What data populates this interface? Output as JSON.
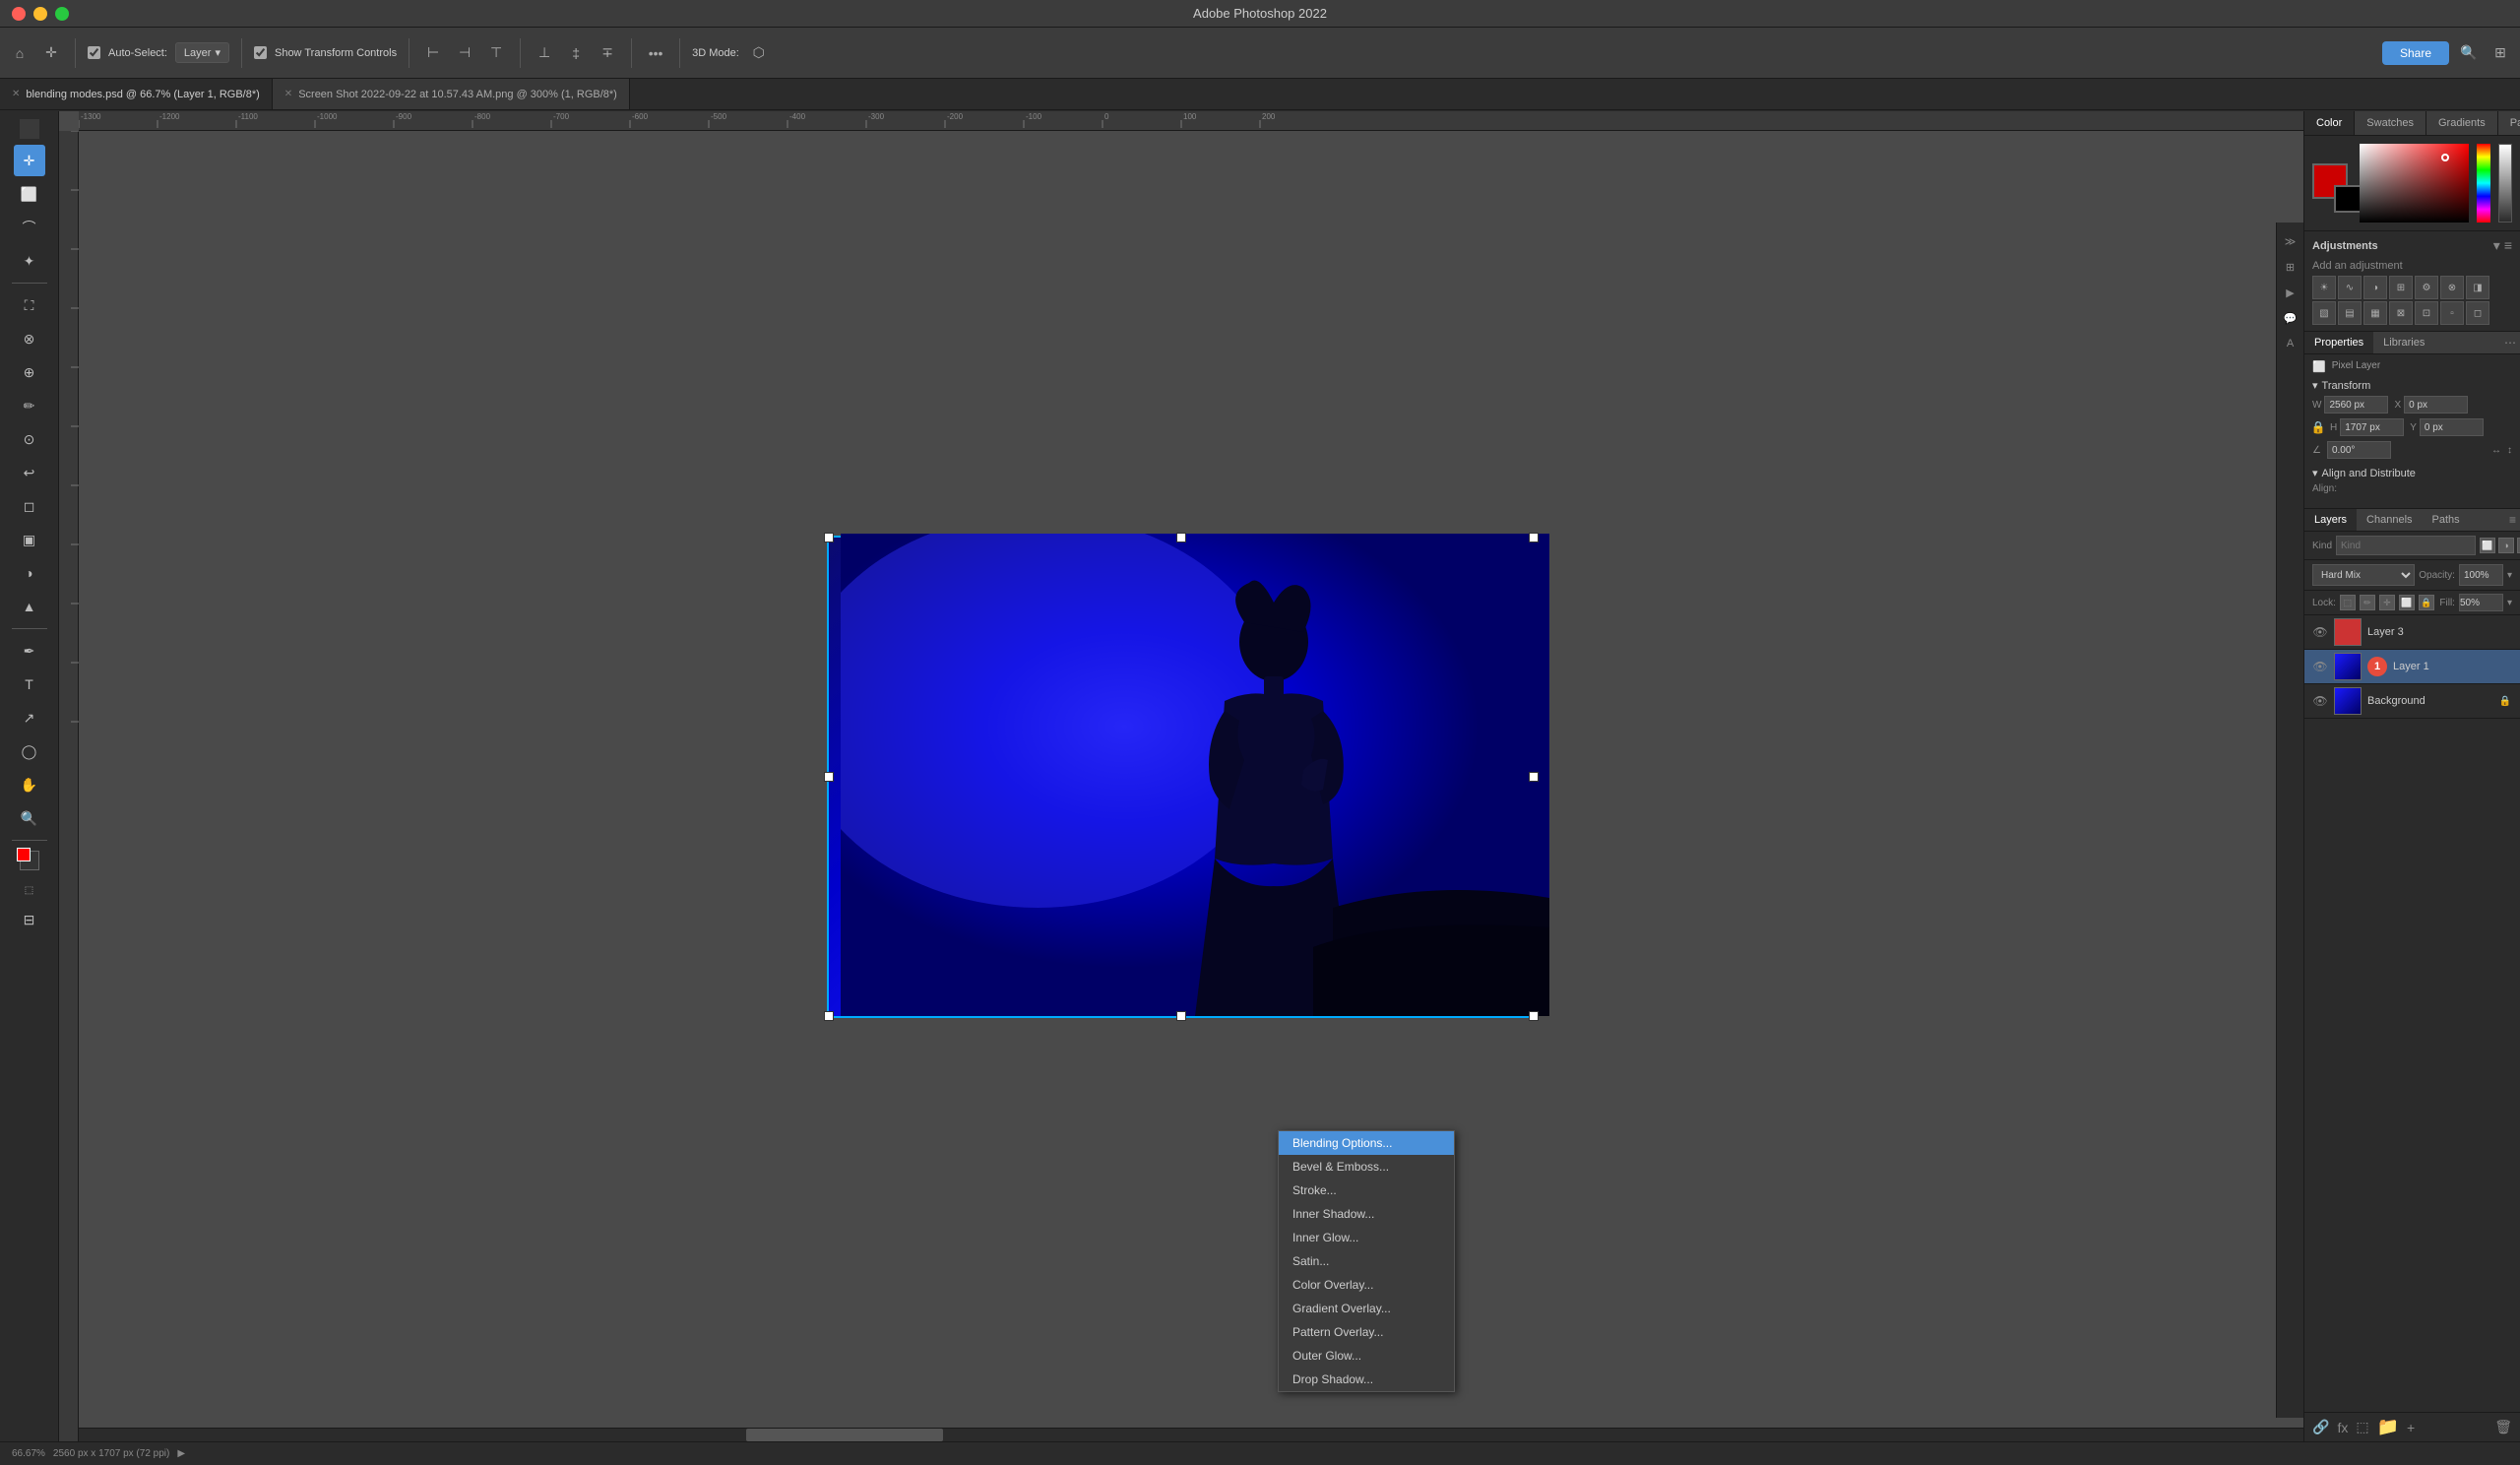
{
  "window": {
    "title": "Adobe Photoshop 2022",
    "controls": {
      "close": "close",
      "minimize": "minimize",
      "maximize": "maximize"
    }
  },
  "toolbar": {
    "auto_select_label": "Auto-Select:",
    "auto_select_type": "Layer",
    "show_transform": "Show Transform Controls",
    "share_label": "Share",
    "more_icon": "•••",
    "threed_label": "3D Mode:"
  },
  "tabs": [
    {
      "label": "blending modes.psd @ 66.7% (Layer 1, RGB/8*)",
      "active": true,
      "modified": true
    },
    {
      "label": "Screen Shot 2022-09-22 at 10.57.43 AM.png @ 300% (1, RGB/8*)",
      "active": false,
      "modified": true
    }
  ],
  "color_panel": {
    "tabs": [
      "Color",
      "Swatches",
      "Gradients",
      "Patterns"
    ],
    "active_tab": "Color"
  },
  "adjustments": {
    "title": "Adjustments",
    "add_label": "Add an adjustment",
    "icons": [
      "☀",
      "▣",
      "◑",
      "⊞",
      "⚙",
      "⊗",
      "✦",
      "◧",
      "◨",
      "▦",
      "⊠",
      "⊡",
      "▫",
      "◻"
    ]
  },
  "properties": {
    "tabs": [
      "Properties",
      "Libraries"
    ],
    "active_tab": "Properties",
    "layer_type": "Pixel Layer",
    "transform": {
      "title": "Transform",
      "w_label": "W",
      "w_value": "2560 px",
      "x_label": "X",
      "x_value": "0 px",
      "h_label": "H",
      "h_value": "1707 px",
      "y_label": "Y",
      "y_value": "0 px",
      "angle_value": "0.00°"
    },
    "align": {
      "title": "Align and Distribute",
      "label": "Align:"
    }
  },
  "layers": {
    "tabs": [
      "Layers",
      "Channels",
      "Paths"
    ],
    "active_tab": "Layers",
    "search_placeholder": "Kind",
    "blend_mode": "Hard Mix",
    "opacity_label": "Opacity:",
    "opacity_value": "100%",
    "lock_label": "Lock:",
    "fill_label": "Fill:",
    "fill_value": "50%",
    "items": [
      {
        "name": "Layer 3",
        "visible": true,
        "color": "#cc3333",
        "active": false
      },
      {
        "name": "Layer 1",
        "visible": true,
        "color": "#4466aa",
        "active": true,
        "has_badge": true
      },
      {
        "name": "Background",
        "visible": true,
        "color": "#334455",
        "active": false,
        "locked": true
      }
    ]
  },
  "context_menu": {
    "items": [
      {
        "label": "Blending Options...",
        "highlighted": true
      },
      {
        "label": "Bevel & Emboss..."
      },
      {
        "label": "Stroke..."
      },
      {
        "label": "Inner Shadow..."
      },
      {
        "label": "Inner Glow..."
      },
      {
        "label": "Satin..."
      },
      {
        "label": "Color Overlay..."
      },
      {
        "label": "Gradient Overlay..."
      },
      {
        "label": "Pattern Overlay..."
      },
      {
        "label": "Outer Glow..."
      },
      {
        "label": "Drop Shadow..."
      }
    ]
  },
  "status_bar": {
    "zoom": "66.67%",
    "dimensions": "2560 px x 1707 px (72 ppi)",
    "arrow": "▶"
  }
}
